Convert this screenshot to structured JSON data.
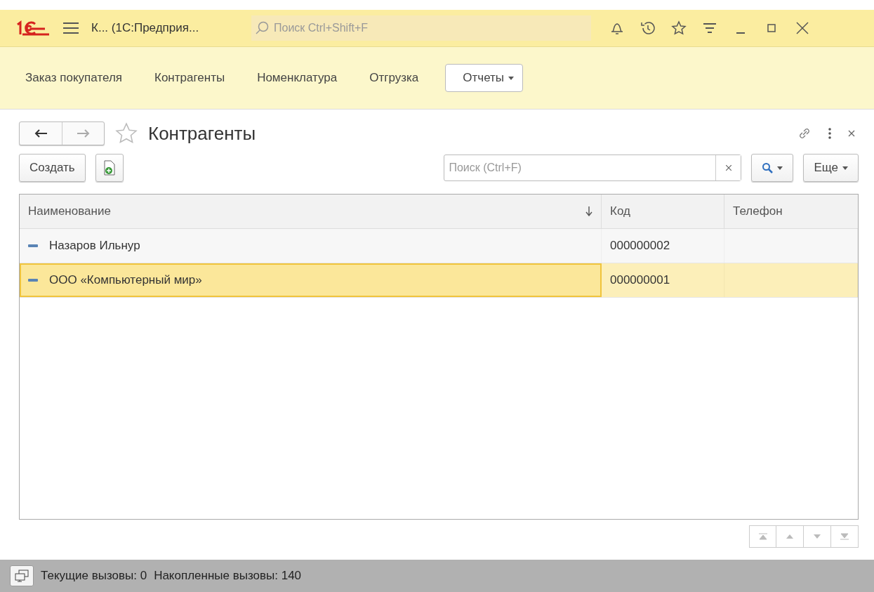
{
  "window": {
    "title": "К...  (1С:Предприя...",
    "search": {
      "placeholder": "Поиск Ctrl+Shift+F"
    }
  },
  "sections": [
    {
      "label": "Заказ покупателя",
      "kind": "link"
    },
    {
      "label": "Контрагенты",
      "kind": "link"
    },
    {
      "label": "Номенклатура",
      "kind": "link"
    },
    {
      "label": "Отгрузка",
      "kind": "link"
    },
    {
      "label": "Отчеты",
      "kind": "dropdown"
    }
  ],
  "form": {
    "title": "Контрагенты",
    "favorite": false,
    "create_button": "Создать",
    "search": {
      "placeholder": "Поиск (Ctrl+F)"
    },
    "more_button": "Еще"
  },
  "table": {
    "columns": [
      {
        "label": "Наименование",
        "sorted": true
      },
      {
        "label": "Код",
        "sorted": false
      },
      {
        "label": "Телефон",
        "sorted": false
      }
    ],
    "rows": [
      {
        "cells": [
          "Назаров Ильнур",
          "000000002",
          ""
        ],
        "selected": false
      },
      {
        "cells": [
          "ООО «Компьютерный мир»",
          "000000001",
          ""
        ],
        "selected": true
      }
    ]
  },
  "status_bar": {
    "current_calls": "Текущие вызовы: 0",
    "accumulated_calls": "Накопленные вызовы: 140"
  }
}
